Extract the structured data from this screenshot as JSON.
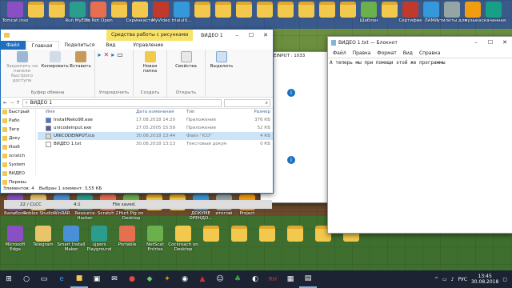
{
  "desktop": {
    "top_icons": [
      "Tomcat.inso",
      "",
      "",
      "Run MyEdit",
      "Do Not Open",
      "",
      "Скринкасты",
      "MyVideo",
      "trialulti...",
      "",
      "",
      "",
      "",
      "",
      "",
      "",
      "",
      "Шаблон",
      "",
      "Сертифик",
      "ЛАМИ",
      "утилиты для",
      "музыка",
      "скачанная"
    ],
    "bottom_icons": [
      "Microsoft Edge",
      "Telegram",
      "Smart Install Maker",
      "ujpers Playground",
      "Portable",
      "NetScat Entries",
      "Cockroach on Desktop",
      "",
      "",
      "",
      "",
      "",
      ""
    ],
    "mid_icons": [
      "Балабола",
      "Roblox Studio",
      "WinRAR",
      "Resource Hacker",
      "Scratch 2",
      "Hurt Pig on Desktop",
      "",
      "",
      "ДОКУМЕ ОРЕНДО...",
      "итогові",
      "Project"
    ]
  },
  "explorer": {
    "title": "ВИДЕО 1",
    "context_tab": "Средства работы с рисунками",
    "tabs": [
      "Файл",
      "Главная",
      "Поделиться",
      "Вид",
      "Управление"
    ],
    "ribbon": {
      "clipboard": {
        "pin": "Закрепить на панели быстрого доступа",
        "copy": "Копировать",
        "paste": "Вставить",
        "label": "Буфер обмена"
      },
      "organize": {
        "label": "Упорядочить"
      },
      "create": {
        "new_folder": "Новая папка",
        "label": "Создать"
      },
      "open": {
        "properties": "Свойства",
        "label": "Открыть"
      },
      "select": {
        "label": "Выделить"
      }
    },
    "address": "ВИДЕО 1",
    "nav": [
      "Быстрый",
      "Рабо",
      "Загр",
      "Доку",
      "Изоб",
      "scratch",
      "System",
      "ВИДЕО",
      "Перевы"
    ],
    "columns": [
      "Имя",
      "Дата изменения",
      "Тип",
      "Размер"
    ],
    "files": [
      {
        "name": "InstallNeko98.exe",
        "date": "17.08.2018 14:20",
        "type": "Приложение",
        "size": "376 КБ"
      },
      {
        "name": "unicodeinput.exe",
        "date": "27.05.2005 15:59",
        "type": "Приложение",
        "size": "52 КБ"
      },
      {
        "name": "UNICODEINPUT.ico",
        "date": "30.08.2018 13:44",
        "type": "Файл \"ICO\"",
        "size": "4 КБ"
      },
      {
        "name": "ВИДЕО 1.txt",
        "date": "30.08.2018 13:13",
        "type": "Текстовый докум",
        "size": "0 КБ"
      }
    ],
    "status": {
      "count": "Элементов: 4",
      "selected": "Выбран 1 элемент: 3,55 КБ"
    }
  },
  "background_window": {
    "title_fragment": "ICODEINPUT : 1033",
    "status": "22 / CLCC",
    "status2": "4:1",
    "saved": "File saved."
  },
  "notepad": {
    "title": "ВИДЕО 1.txt — Блокнот",
    "menu": [
      "Файл",
      "Правка",
      "Формат",
      "Вид",
      "Справка"
    ],
    "text": "А теперь мы при помощи этой же программы"
  },
  "taskbar": {
    "time": "13:45",
    "date": "30.08.2018",
    "lang": "РУС"
  },
  "colors": {
    "accent": "#1f6fbf",
    "selected_row": "#cce4f7",
    "context_tab": "#f8e36a"
  }
}
